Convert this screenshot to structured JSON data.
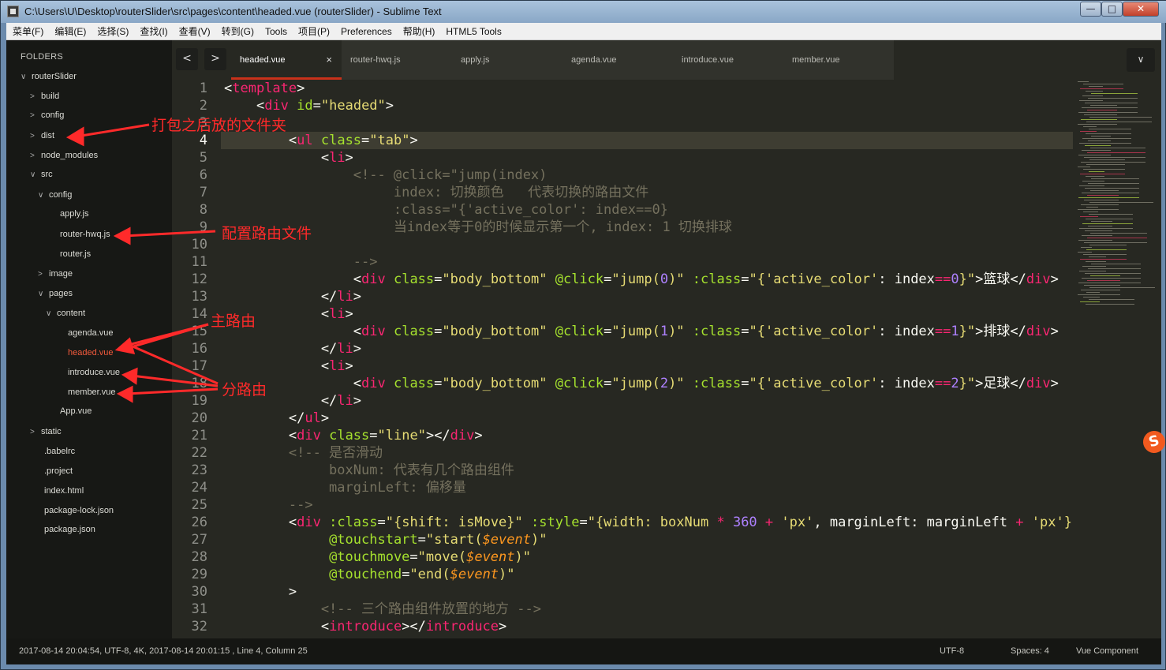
{
  "window": {
    "title": "C:\\Users\\U\\Desktop\\routerSlider\\src\\pages\\content\\headed.vue (routerSlider) - Sublime Text",
    "min_glyph": "—",
    "max_glyph": "□",
    "close_glyph": "✕"
  },
  "menu": [
    "菜单(F)",
    "编辑(E)",
    "选择(S)",
    "查找(I)",
    "查看(V)",
    "转到(G)",
    "Tools",
    "项目(P)",
    "Preferences",
    "帮助(H)",
    "HTML5 Tools"
  ],
  "sidebar": {
    "title": "FOLDERS",
    "tree": [
      {
        "label": "routerSlider",
        "arrow": "∨"
      },
      {
        "label": "build",
        "arrow": ">"
      },
      {
        "label": "config",
        "arrow": ">"
      },
      {
        "label": "dist",
        "arrow": ">"
      },
      {
        "label": "node_modules",
        "arrow": ">"
      },
      {
        "label": "src",
        "arrow": "∨"
      },
      {
        "label": "config",
        "arrow": "∨"
      },
      {
        "label": "apply.js",
        "arrow": ""
      },
      {
        "label": "router-hwq.js",
        "arrow": ""
      },
      {
        "label": "router.js",
        "arrow": ""
      },
      {
        "label": "image",
        "arrow": ">"
      },
      {
        "label": "pages",
        "arrow": "∨"
      },
      {
        "label": "content",
        "arrow": "∨"
      },
      {
        "label": "agenda.vue",
        "arrow": ""
      },
      {
        "label": "headed.vue",
        "arrow": ""
      },
      {
        "label": "introduce.vue",
        "arrow": ""
      },
      {
        "label": "member.vue",
        "arrow": ""
      },
      {
        "label": "App.vue",
        "arrow": ""
      },
      {
        "label": "static",
        "arrow": ">"
      },
      {
        "label": ".babelrc",
        "arrow": ""
      },
      {
        "label": ".project",
        "arrow": ""
      },
      {
        "label": "index.html",
        "arrow": ""
      },
      {
        "label": "package-lock.json",
        "arrow": ""
      },
      {
        "label": "package.json",
        "arrow": ""
      }
    ]
  },
  "tabs": {
    "prev": "<",
    "next": ">",
    "items": [
      "headed.vue",
      "router-hwq.js",
      "apply.js",
      "agenda.vue",
      "introduce.vue",
      "member.vue"
    ],
    "close_glyph": "×",
    "dropdown": "∨"
  },
  "editor": {
    "line_numbers": [
      "1",
      "2",
      "3",
      "4",
      "5",
      "6",
      "7",
      "8",
      "9",
      "10",
      "11",
      "12",
      "13",
      "14",
      "15",
      "16",
      "17",
      "18",
      "19",
      "20",
      "21",
      "22",
      "23",
      "24",
      "25",
      "26",
      "27",
      "28",
      "29",
      "30",
      "31",
      "32"
    ],
    "current_line": "4",
    "lines": [
      [
        [
          "w",
          "<"
        ],
        [
          "t",
          "template"
        ],
        [
          "w",
          ">"
        ]
      ],
      [
        [
          "w",
          "    <"
        ],
        [
          "t",
          "div"
        ],
        [
          "w",
          " "
        ],
        [
          "a",
          "id"
        ],
        [
          "w",
          "="
        ],
        [
          "s",
          "\"headed\""
        ],
        [
          "w",
          ">"
        ]
      ],
      [],
      [
        [
          "w",
          "        <"
        ],
        [
          "t",
          "ul"
        ],
        [
          "w",
          " "
        ],
        [
          "a",
          "class"
        ],
        [
          "w",
          "="
        ],
        [
          "s",
          "\"tab\""
        ],
        [
          "w",
          ">"
        ]
      ],
      [
        [
          "w",
          "            <"
        ],
        [
          "t",
          "li"
        ],
        [
          "w",
          ">"
        ]
      ],
      [
        [
          "c",
          "                <!-- @click=\"jump(index)"
        ]
      ],
      [
        [
          "c",
          "                     index: 切换颜色   代表切换的路由文件"
        ]
      ],
      [
        [
          "c",
          "                     :class=\"{'active_color': index==0}"
        ]
      ],
      [
        [
          "c",
          "                     当index等于0的时候显示第一个, index: 1 切换排球"
        ]
      ],
      [],
      [
        [
          "c",
          "                -->"
        ]
      ],
      [
        [
          "w",
          "                <"
        ],
        [
          "t",
          "div"
        ],
        [
          "w",
          " "
        ],
        [
          "a",
          "class"
        ],
        [
          "w",
          "="
        ],
        [
          "s",
          "\"body_bottom\""
        ],
        [
          "w",
          " "
        ],
        [
          "a",
          "@click"
        ],
        [
          "w",
          "="
        ],
        [
          "s",
          "\"jump("
        ],
        [
          "n",
          "0"
        ],
        [
          "s",
          ")\""
        ],
        [
          "w",
          " "
        ],
        [
          "a",
          ":class"
        ],
        [
          "w",
          "="
        ],
        [
          "s",
          "\"{"
        ],
        [
          "s",
          "'active_color'"
        ],
        [
          "w",
          ": index"
        ],
        [
          "t",
          "=="
        ],
        [
          "n",
          "0"
        ],
        [
          "s",
          "}\""
        ],
        [
          "w",
          ">篮球</"
        ],
        [
          "t",
          "div"
        ],
        [
          "w",
          ">"
        ]
      ],
      [
        [
          "w",
          "            </"
        ],
        [
          "t",
          "li"
        ],
        [
          "w",
          ">"
        ]
      ],
      [
        [
          "w",
          "            <"
        ],
        [
          "t",
          "li"
        ],
        [
          "w",
          ">"
        ]
      ],
      [
        [
          "w",
          "                <"
        ],
        [
          "t",
          "div"
        ],
        [
          "w",
          " "
        ],
        [
          "a",
          "class"
        ],
        [
          "w",
          "="
        ],
        [
          "s",
          "\"body_bottom\""
        ],
        [
          "w",
          " "
        ],
        [
          "a",
          "@click"
        ],
        [
          "w",
          "="
        ],
        [
          "s",
          "\"jump("
        ],
        [
          "n",
          "1"
        ],
        [
          "s",
          ")\""
        ],
        [
          "w",
          " "
        ],
        [
          "a",
          ":class"
        ],
        [
          "w",
          "="
        ],
        [
          "s",
          "\"{"
        ],
        [
          "s",
          "'active_color'"
        ],
        [
          "w",
          ": index"
        ],
        [
          "t",
          "=="
        ],
        [
          "n",
          "1"
        ],
        [
          "s",
          "}\""
        ],
        [
          "w",
          ">排球</"
        ],
        [
          "t",
          "div"
        ],
        [
          "w",
          ">"
        ]
      ],
      [
        [
          "w",
          "            </"
        ],
        [
          "t",
          "li"
        ],
        [
          "w",
          ">"
        ]
      ],
      [
        [
          "w",
          "            <"
        ],
        [
          "t",
          "li"
        ],
        [
          "w",
          ">"
        ]
      ],
      [
        [
          "w",
          "                <"
        ],
        [
          "t",
          "div"
        ],
        [
          "w",
          " "
        ],
        [
          "a",
          "class"
        ],
        [
          "w",
          "="
        ],
        [
          "s",
          "\"body_bottom\""
        ],
        [
          "w",
          " "
        ],
        [
          "a",
          "@click"
        ],
        [
          "w",
          "="
        ],
        [
          "s",
          "\"jump("
        ],
        [
          "n",
          "2"
        ],
        [
          "s",
          ")\""
        ],
        [
          "w",
          " "
        ],
        [
          "a",
          ":class"
        ],
        [
          "w",
          "="
        ],
        [
          "s",
          "\"{"
        ],
        [
          "s",
          "'active_color'"
        ],
        [
          "w",
          ": index"
        ],
        [
          "t",
          "=="
        ],
        [
          "n",
          "2"
        ],
        [
          "s",
          "}\""
        ],
        [
          "w",
          ">足球</"
        ],
        [
          "t",
          "div"
        ],
        [
          "w",
          ">"
        ]
      ],
      [
        [
          "w",
          "            </"
        ],
        [
          "t",
          "li"
        ],
        [
          "w",
          ">"
        ]
      ],
      [
        [
          "w",
          "        </"
        ],
        [
          "t",
          "ul"
        ],
        [
          "w",
          ">"
        ]
      ],
      [
        [
          "w",
          "        <"
        ],
        [
          "t",
          "div"
        ],
        [
          "w",
          " "
        ],
        [
          "a",
          "class"
        ],
        [
          "w",
          "="
        ],
        [
          "s",
          "\"line\""
        ],
        [
          "w",
          "></"
        ],
        [
          "t",
          "div"
        ],
        [
          "w",
          ">"
        ]
      ],
      [
        [
          "c",
          "        <!-- 是否滑动"
        ]
      ],
      [
        [
          "c",
          "             boxNum: 代表有几个路由组件"
        ]
      ],
      [
        [
          "c",
          "             marginLeft: 偏移量"
        ]
      ],
      [
        [
          "c",
          "        -->"
        ]
      ],
      [
        [
          "w",
          "        <"
        ],
        [
          "t",
          "div"
        ],
        [
          "w",
          " "
        ],
        [
          "a",
          ":class"
        ],
        [
          "w",
          "="
        ],
        [
          "s",
          "\"{shift: isMove}\""
        ],
        [
          "w",
          " "
        ],
        [
          "a",
          ":style"
        ],
        [
          "w",
          "="
        ],
        [
          "s",
          "\"{width: boxNum "
        ],
        [
          "t",
          "*"
        ],
        [
          "w",
          " "
        ],
        [
          "n",
          "360"
        ],
        [
          "w",
          " "
        ],
        [
          "t",
          "+"
        ],
        [
          "w",
          " "
        ],
        [
          "s",
          "'px'"
        ],
        [
          "w",
          ", marginLeft: marginLeft "
        ],
        [
          "t",
          "+"
        ],
        [
          "w",
          " "
        ],
        [
          "s",
          "'px'"
        ],
        [
          "s",
          "}\""
        ]
      ],
      [
        [
          "w",
          "             "
        ],
        [
          "a",
          "@touchstart"
        ],
        [
          "w",
          "="
        ],
        [
          "s",
          "\"start("
        ],
        [
          "v",
          "$event"
        ],
        [
          "s",
          ")\""
        ]
      ],
      [
        [
          "w",
          "             "
        ],
        [
          "a",
          "@touchmove"
        ],
        [
          "w",
          "="
        ],
        [
          "s",
          "\"move("
        ],
        [
          "v",
          "$event"
        ],
        [
          "s",
          ")\""
        ]
      ],
      [
        [
          "w",
          "             "
        ],
        [
          "a",
          "@touchend"
        ],
        [
          "w",
          "="
        ],
        [
          "s",
          "\"end("
        ],
        [
          "v",
          "$event"
        ],
        [
          "s",
          ")\""
        ]
      ],
      [
        [
          "w",
          "        >"
        ]
      ],
      [
        [
          "c",
          "            <!-- 三个路由组件放置的地方 -->"
        ]
      ],
      [
        [
          "w",
          "            <"
        ],
        [
          "t",
          "introduce"
        ],
        [
          "w",
          "></"
        ],
        [
          "t",
          "introduce"
        ],
        [
          "w",
          ">"
        ]
      ]
    ]
  },
  "status": {
    "left": "2017-08-14 20:04:54, UTF-8, 4K, 2017-08-14 20:01:15 , Line 4, Column 25",
    "encoding": "UTF-8",
    "spaces": "Spaces: 4",
    "syntax": "Vue Component"
  },
  "annotations": {
    "dist": "打包之后放的文件夹",
    "router": "配置路由文件",
    "main_route": "主路由",
    "sub_route": "分路由"
  },
  "ime_badge": "S"
}
